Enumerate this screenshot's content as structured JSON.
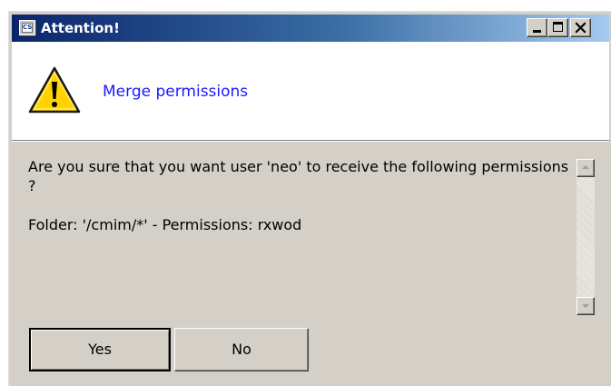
{
  "window": {
    "title": "Attention!",
    "app_icon": "cs-app-icon",
    "app_icon_text": "CS",
    "controls": {
      "minimize": "minimize-icon",
      "maximize": "maximize-icon",
      "close": "close-icon"
    }
  },
  "header": {
    "icon": "warning-icon",
    "title": "Merge permissions"
  },
  "message": {
    "question": "Are you sure that you want user 'neo' to receive the following permissions ?",
    "detail": "Folder: '/cmim/*' - Permissions: rxwod"
  },
  "buttons": {
    "yes": "Yes",
    "no": "No"
  },
  "colors": {
    "titlebar_start": "#0a246a",
    "titlebar_end": "#a6caf0",
    "header_title": "#1a1aff",
    "dialog_face": "#d4d0c8",
    "warning_fill": "#ffd200"
  }
}
